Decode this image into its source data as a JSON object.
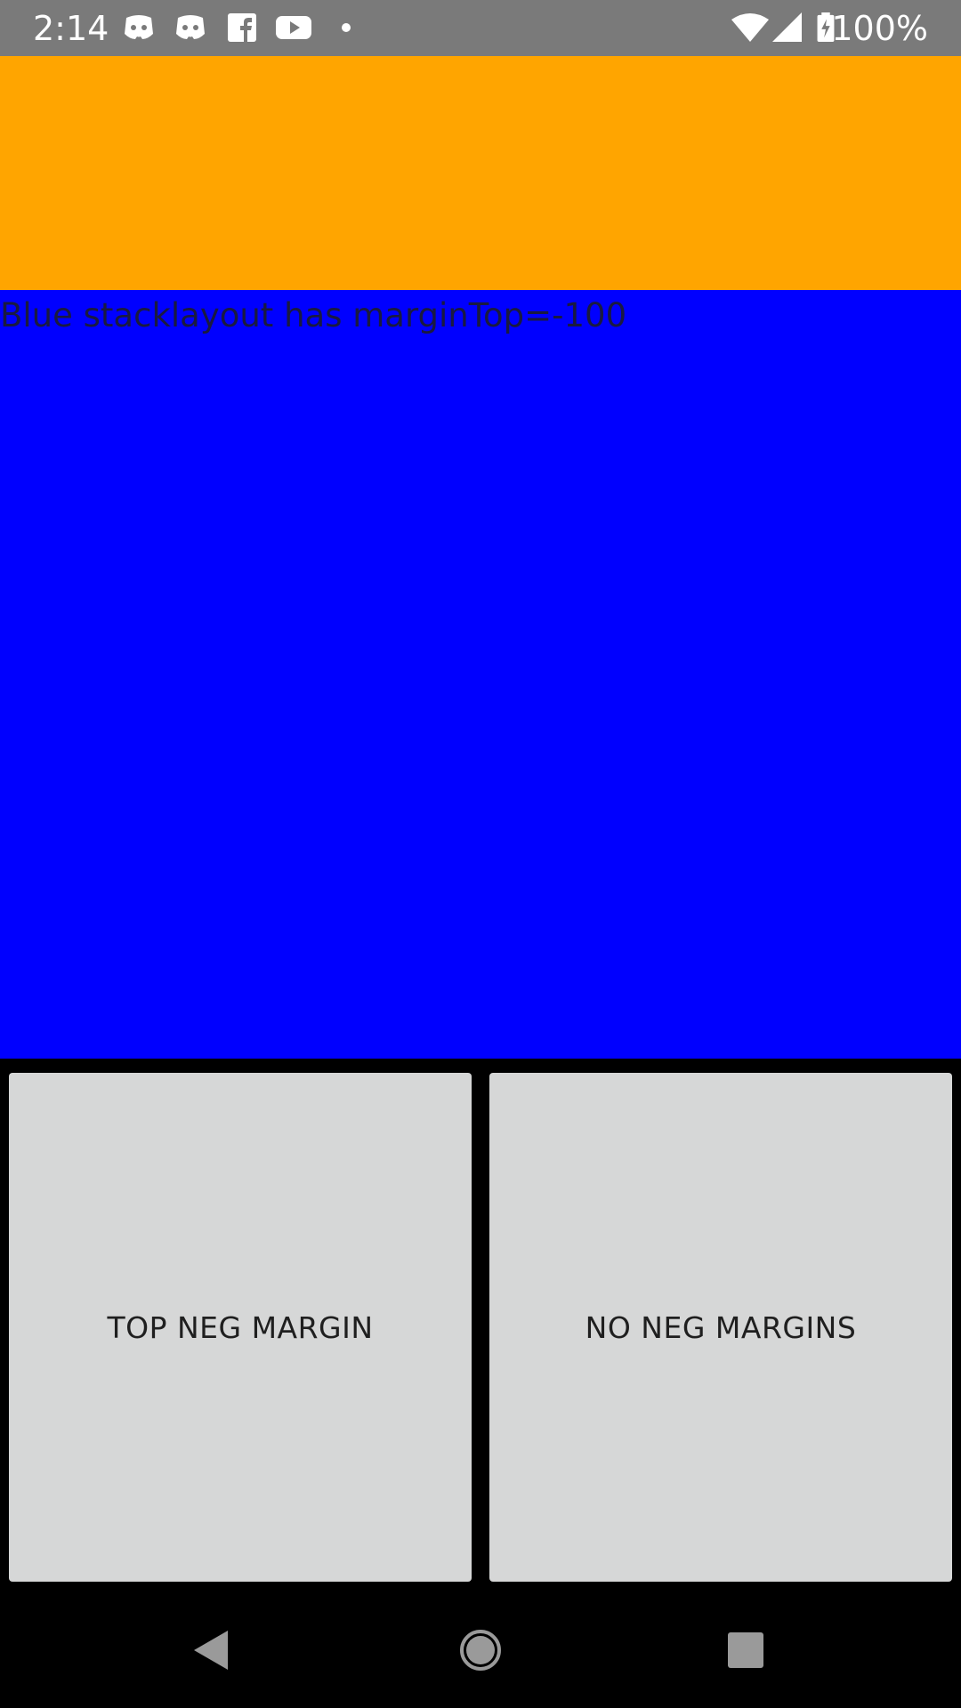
{
  "status_bar": {
    "time": "2:14",
    "battery": "100%",
    "icons": [
      "discord-icon",
      "discord-icon",
      "facebook-icon",
      "youtube-icon",
      "dot-icon",
      "wifi-icon",
      "signal-icon",
      "battery-icon"
    ],
    "background": "#7a7a7a"
  },
  "main": {
    "orange_color": "#ffa500",
    "blue_color": "#0000ff",
    "blue_label": "Blue stacklayout has marginTop=-100"
  },
  "buttons": {
    "top_neg_margin": "TOP NEG MARGIN",
    "no_neg_margins": "NO NEG MARGINS"
  },
  "nav": {
    "items": [
      "back-icon",
      "home-icon",
      "recents-icon"
    ]
  }
}
